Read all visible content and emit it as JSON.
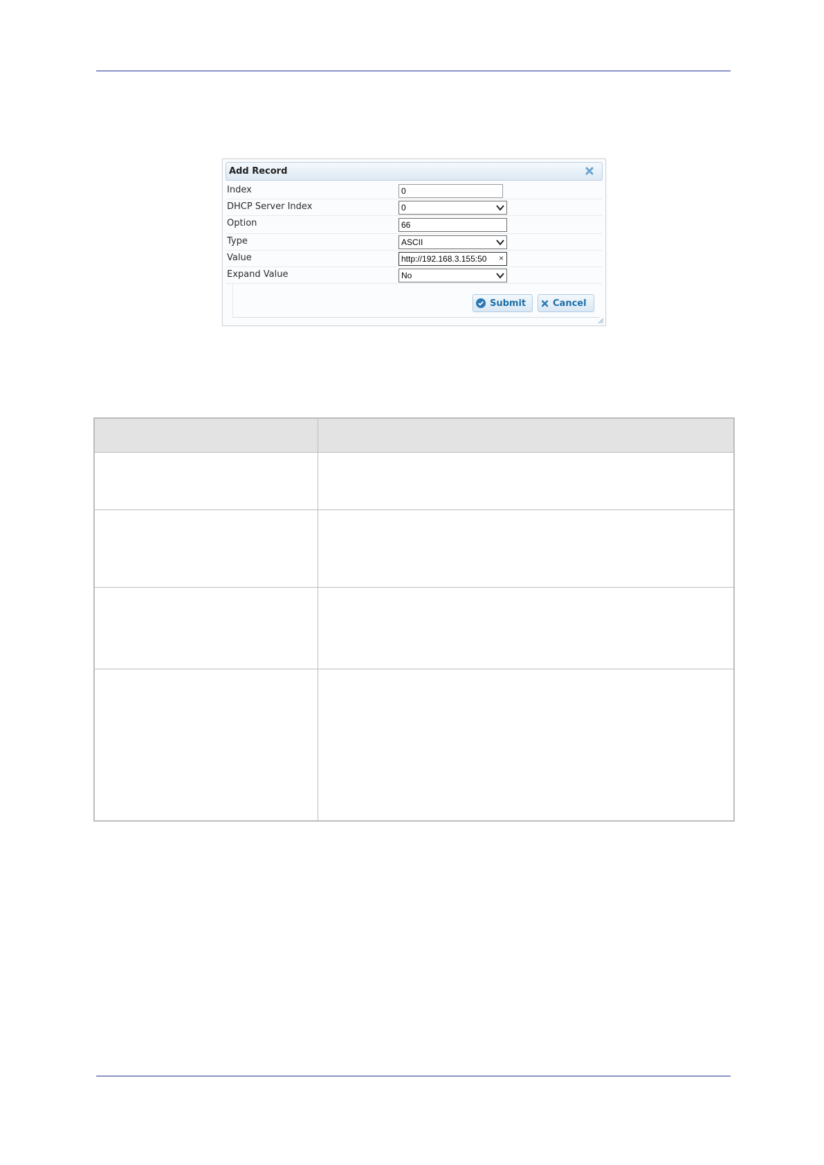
{
  "dialog": {
    "title": "Add Record",
    "fields": [
      {
        "label": "Index",
        "value": "0",
        "kind": "text"
      },
      {
        "label": "DHCP Server Index",
        "value": "0",
        "kind": "select"
      },
      {
        "label": "Option",
        "value": "66",
        "kind": "text"
      },
      {
        "label": "Type",
        "value": "ASCII",
        "kind": "select"
      },
      {
        "label": "Value",
        "value": "http://192.168.3.155:50",
        "kind": "text-clearable"
      },
      {
        "label": "Expand Value",
        "value": "No",
        "kind": "select"
      }
    ],
    "submit_label": "Submit",
    "cancel_label": "Cancel",
    "clear_glyph": "×"
  },
  "colors": {
    "rule": "#1f2f8f",
    "button_text": "#1c6fa8",
    "table_header": "#e3e3e3"
  },
  "icons": [
    "close-icon",
    "chevron-down-icon",
    "check-circle-icon",
    "x-icon",
    "resize-grip-icon"
  ]
}
